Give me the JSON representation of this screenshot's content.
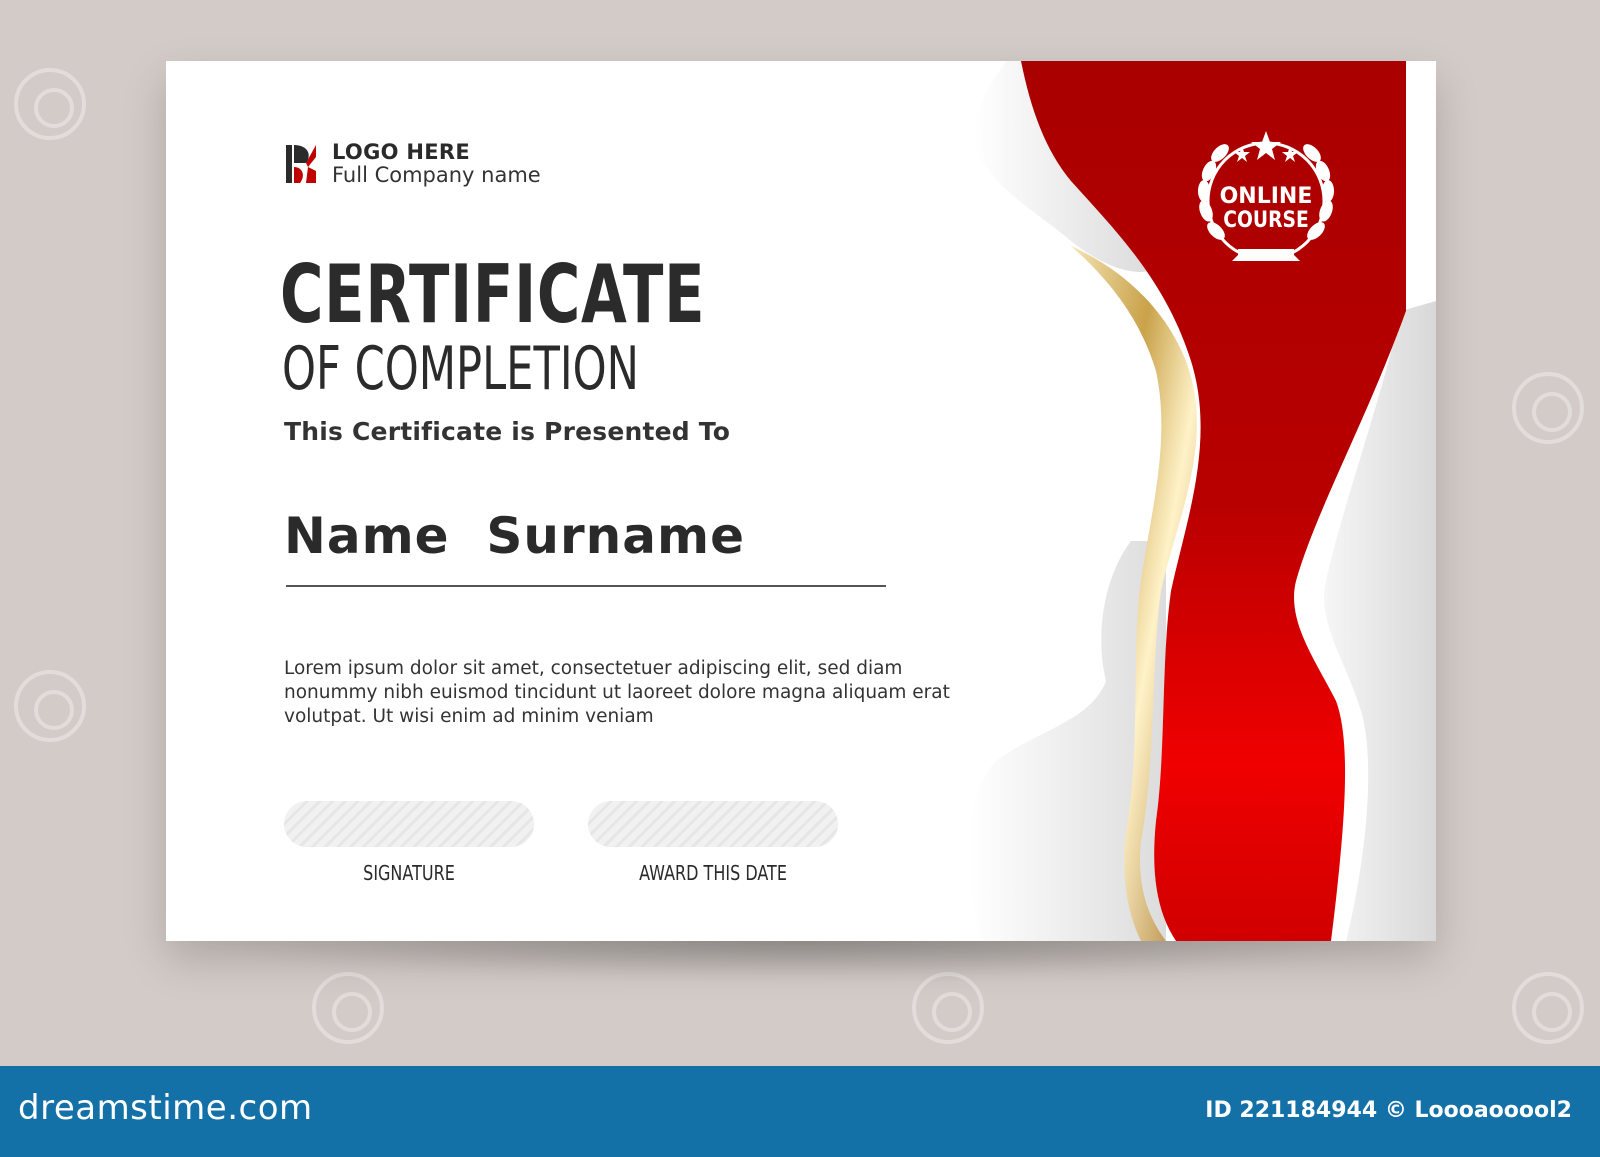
{
  "logo": {
    "line1": "LOGO HERE",
    "line2": "Full Company name"
  },
  "title": {
    "main": "CERTIFICATE",
    "sub": "OF COMPLETION"
  },
  "presented_to": "This Certificate is Presented To",
  "recipient_name": "Name  Surname",
  "body_text": "Lorem ipsum dolor sit amet, consectetuer adipiscing elit, sed diam nonummy nibh euismod tincidunt ut laoreet dolore magna aliquam erat volutpat. Ut wisi enim ad minim veniam",
  "signature_label": "SIGNATURE",
  "date_label": "AWARD THIS DATE",
  "badge": {
    "line1": "ONLINE",
    "line2": "COURSE"
  },
  "footer": {
    "brand": "dreamstime.com",
    "id_text": "ID 221184944 © Loooaooool2"
  },
  "colors": {
    "accent_red": "#c00000",
    "gold": "#c9a24a",
    "footer_blue": "#1471a8"
  }
}
